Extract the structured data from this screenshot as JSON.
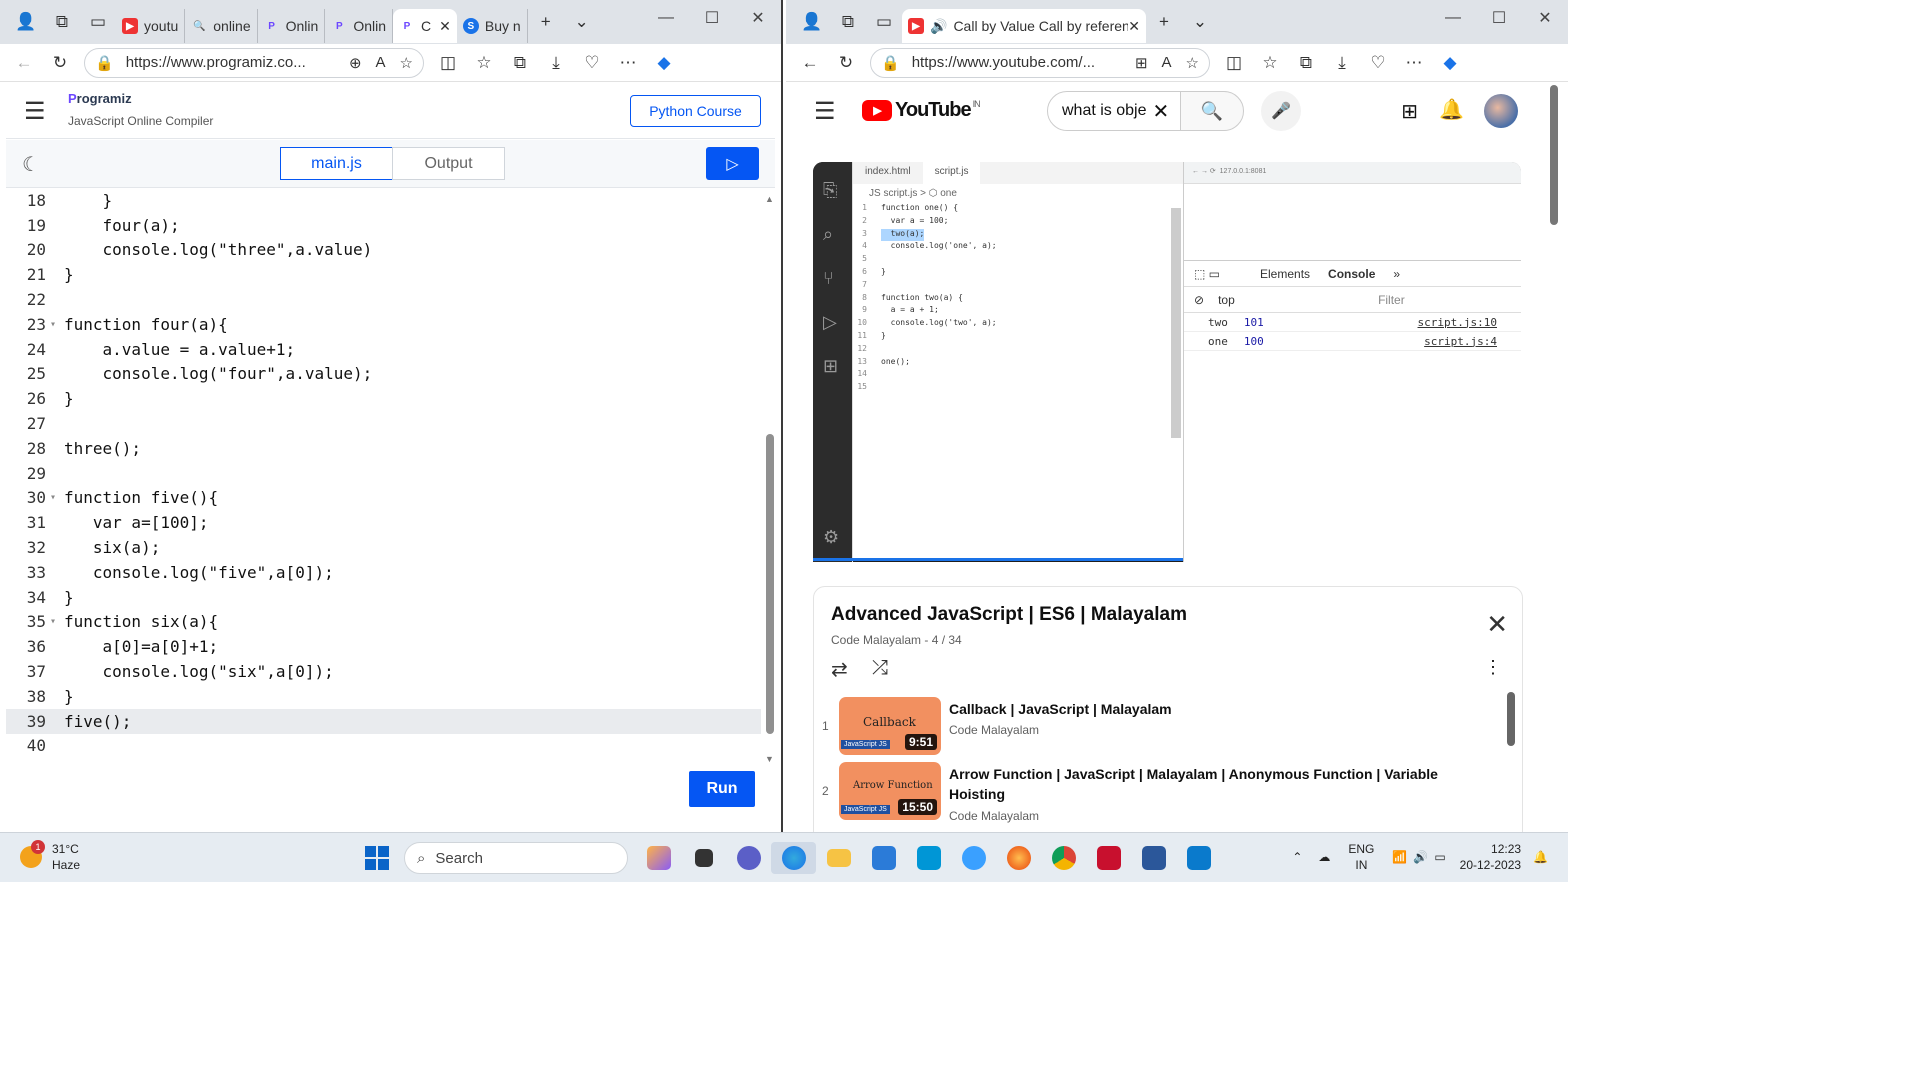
{
  "left_window": {
    "tabs": [
      {
        "label": "youtu",
        "icon": "youtube-icon"
      },
      {
        "label": "online",
        "icon": "search-icon"
      },
      {
        "label": "Onlin",
        "icon": "programiz-icon"
      },
      {
        "label": "Onlin",
        "icon": "programiz-icon"
      },
      {
        "label": "C",
        "icon": "programiz-icon",
        "active": true
      },
      {
        "label": "Buy n",
        "icon": "s-icon"
      }
    ],
    "url": "https://www.programiz.co...",
    "programiz": {
      "logo_text": "rogramiz",
      "subtitle": "JavaScript Online Compiler",
      "course_button": "Python Course",
      "tab_main": "main.js",
      "tab_output": "Output",
      "run_button": "Run"
    },
    "code_lines": [
      {
        "n": "18",
        "t": "    }",
        "fold": ""
      },
      {
        "n": "19",
        "t": "    four(a);",
        "fold": ""
      },
      {
        "n": "20",
        "t": "    console.log(\"three\",a.value)",
        "fold": ""
      },
      {
        "n": "21",
        "t": "}",
        "fold": ""
      },
      {
        "n": "22",
        "t": "",
        "fold": ""
      },
      {
        "n": "23",
        "t": "function four(a){",
        "fold": "▾"
      },
      {
        "n": "24",
        "t": "    a.value = a.value+1;",
        "fold": ""
      },
      {
        "n": "25",
        "t": "    console.log(\"four\",a.value);",
        "fold": ""
      },
      {
        "n": "26",
        "t": "}",
        "fold": ""
      },
      {
        "n": "27",
        "t": "",
        "fold": ""
      },
      {
        "n": "28",
        "t": "three();",
        "fold": ""
      },
      {
        "n": "29",
        "t": "",
        "fold": ""
      },
      {
        "n": "30",
        "t": "function five(){",
        "fold": "▾"
      },
      {
        "n": "31",
        "t": "   var a=[100];",
        "fold": ""
      },
      {
        "n": "32",
        "t": "   six(a);",
        "fold": ""
      },
      {
        "n": "33",
        "t": "   console.log(\"five\",a[0]);",
        "fold": ""
      },
      {
        "n": "34",
        "t": "}",
        "fold": ""
      },
      {
        "n": "35",
        "t": "function six(a){",
        "fold": "▾"
      },
      {
        "n": "36",
        "t": "    a[0]=a[0]+1;",
        "fold": ""
      },
      {
        "n": "37",
        "t": "    console.log(\"six\",a[0]);",
        "fold": ""
      },
      {
        "n": "38",
        "t": "}",
        "fold": ""
      },
      {
        "n": "39",
        "t": "five();",
        "fold": "",
        "current": true
      },
      {
        "n": "40",
        "t": "",
        "fold": ""
      }
    ]
  },
  "right_window": {
    "tab_title": "Call by Value Call by referen",
    "url": "https://www.youtube.com/...",
    "youtube": {
      "logo": "YouTube",
      "region": "IN",
      "search_value": "what  is obje"
    },
    "video": {
      "vscode_tabs": [
        "index.html",
        "script.js"
      ],
      "breadcrumb": "JS script.js > ⬡ one",
      "code": [
        {
          "n": "1",
          "t": "function one() {"
        },
        {
          "n": "2",
          "t": "  var a = 100;"
        },
        {
          "n": "3",
          "t": "  two(a);"
        },
        {
          "n": "4",
          "t": "  console.log('one', a);"
        },
        {
          "n": "5",
          "t": ""
        },
        {
          "n": "6",
          "t": "}"
        },
        {
          "n": "7",
          "t": ""
        },
        {
          "n": "8",
          "t": "function two(a) {"
        },
        {
          "n": "9",
          "t": "  a = a + 1;"
        },
        {
          "n": "10",
          "t": "  console.log('two', a);"
        },
        {
          "n": "11",
          "t": "}"
        },
        {
          "n": "12",
          "t": ""
        },
        {
          "n": "13",
          "t": "one();"
        },
        {
          "n": "14",
          "t": ""
        },
        {
          "n": "15",
          "t": ""
        }
      ],
      "browser_url": "127.0.0.1:8081",
      "devtools_tabs": [
        "Elements",
        "Console"
      ],
      "devtools_context": "top",
      "devtools_filter": "Filter",
      "console_rows": [
        {
          "label": "two",
          "value": "101",
          "src": "script.js:10"
        },
        {
          "label": "one",
          "value": "100",
          "src": "script.js:4"
        }
      ]
    },
    "playlist": {
      "title": "Advanced JavaScript | ES6 | Malayalam",
      "channel_progress": "Code Malayalam - 4 / 34",
      "items": [
        {
          "num": "1",
          "thumb": "Callback",
          "duration": "9:51",
          "title": "Callback | JavaScript | Malayalam",
          "channel": "Code Malayalam"
        },
        {
          "num": "2",
          "thumb": "Arrow Function",
          "duration": "15:50",
          "title": "Arrow Function | JavaScript | Malayalam | Anonymous Function | Variable Hoisting",
          "channel": "Code Malayalam"
        }
      ]
    }
  },
  "taskbar": {
    "weather_badge": "1",
    "temperature": "31°C",
    "condition": "Haze",
    "search": "Search",
    "lang": "ENG",
    "region": "IN",
    "time": "12:23",
    "date": "20-12-2023"
  }
}
